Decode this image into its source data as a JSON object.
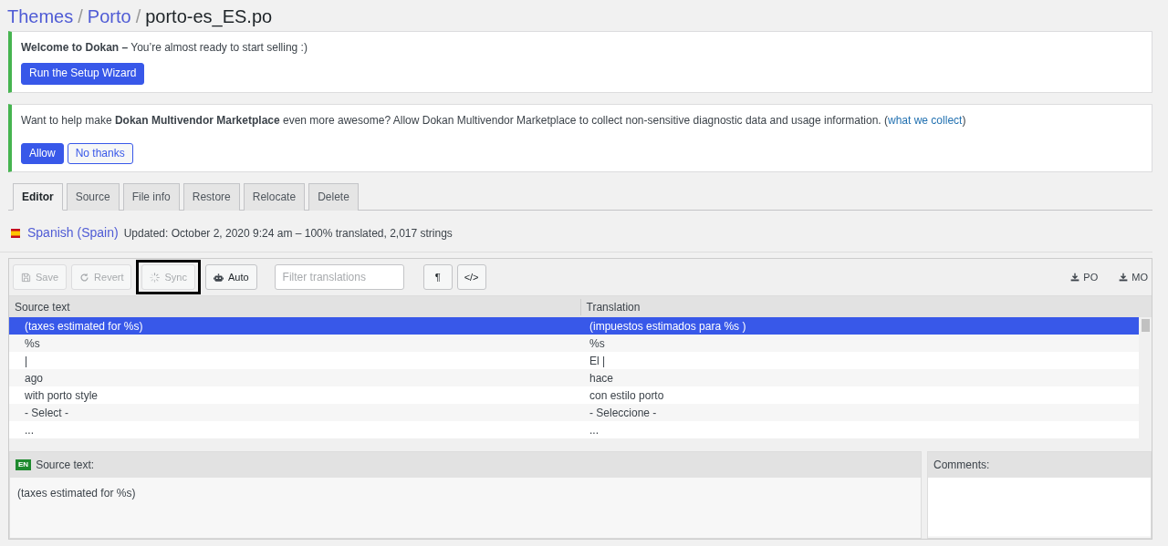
{
  "breadcrumb": [
    {
      "label": "Themes",
      "kind": "link"
    },
    {
      "label": "/",
      "kind": "separator"
    },
    {
      "label": "Porto",
      "kind": "link"
    },
    {
      "label": "/",
      "kind": "separator"
    },
    {
      "label": "porto-es_ES.po",
      "kind": "current"
    }
  ],
  "notices": [
    {
      "text": "**Welcome to Dokan –** You’re almost ready to start selling :)",
      "buttons": [
        {
          "label": "Run the Setup Wizard",
          "kind": "primary"
        }
      ]
    },
    {
      "text": "Want to help make **Dokan Multivendor Marketplace** even more awesome? Allow Dokan Multivendor Marketplace to collect non-sensitive diagnostic data and usage information. (",
      "link": "what we collect",
      "text_after": ")",
      "buttons": [
        {
          "label": "Allow",
          "kind": "primary"
        },
        {
          "label": "No thanks",
          "kind": "outline"
        }
      ]
    }
  ],
  "tabs": [
    {
      "label": "Editor",
      "selected": true
    },
    {
      "label": "Source",
      "selected": false
    },
    {
      "label": "File info",
      "selected": false
    },
    {
      "label": "Restore",
      "selected": false
    },
    {
      "label": "Relocate",
      "selected": false
    },
    {
      "label": "Delete",
      "selected": false
    }
  ],
  "language": {
    "name": "Spanish (Spain)",
    "info": "Updated: October 2, 2020 9:24 am – 100% translated, 2,017 strings"
  },
  "toolbar": {
    "buttons": [
      {
        "label": "Save",
        "disabled": true,
        "highlighted": false
      },
      {
        "label": "Revert",
        "disabled": true,
        "highlighted": false
      },
      {
        "label": "Sync",
        "disabled": true,
        "highlighted": true
      },
      {
        "label": "Auto",
        "disabled": false,
        "highlighted": false
      }
    ],
    "filter": {
      "placeholder": "Filter translations"
    },
    "toggles": [
      "¶",
      "</>"
    ],
    "downloads": [
      "PO",
      "MO"
    ]
  },
  "table": {
    "columns": [
      "Source text",
      "Translation"
    ],
    "rows": [
      {
        "source": "(taxes estimated for %s)",
        "translation": "(impuestos estimados para %s )",
        "selected": true
      },
      {
        "source": "%s",
        "translation": "%s",
        "selected": false
      },
      {
        "source": "|",
        "translation": "El |",
        "selected": false
      },
      {
        "source": "ago",
        "translation": "hace",
        "selected": false
      },
      {
        "source": "with porto style",
        "translation": "con estilo porto",
        "selected": false
      },
      {
        "source": "- Select -",
        "translation": "- Seleccione -",
        "selected": false
      },
      {
        "source": "...",
        "translation": "...",
        "selected": false
      }
    ]
  },
  "source_pane": {
    "lang": "EN",
    "title": "Source text:",
    "text": "(taxes estimated for %s)"
  },
  "comments_pane": {
    "title": "Comments:"
  }
}
